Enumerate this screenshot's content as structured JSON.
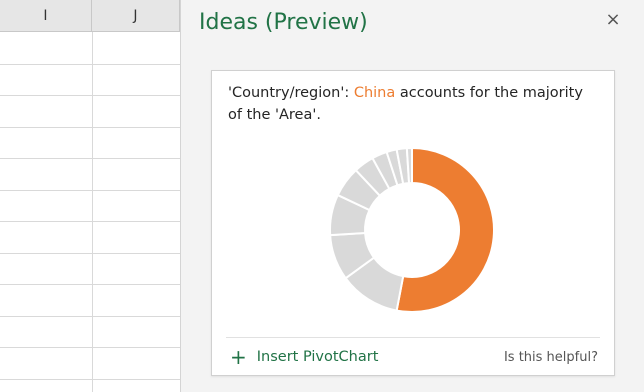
{
  "sheet": {
    "columns": [
      "I",
      "J"
    ]
  },
  "pane": {
    "title": "Ideas (Preview)",
    "close_symbol": "×"
  },
  "card": {
    "insight_prefix": "'Country/region': ",
    "insight_highlight": "China",
    "insight_suffix": " accounts for the majority of the 'Area'.",
    "insert_symbol": "+",
    "insert_label": "Insert PivotChart",
    "helpful_label": "Is this helpful?"
  },
  "colors": {
    "accent_green": "#217346",
    "highlight_orange": "#ed7d31",
    "slice_gray": "#d9d9d9"
  },
  "chart_data": {
    "type": "pie",
    "categories": [
      "China",
      "",
      "",
      "",
      "",
      "",
      "",
      "",
      "",
      ""
    ],
    "values": [
      53,
      12,
      9,
      8,
      6,
      4,
      3,
      2,
      2,
      1
    ],
    "title": "",
    "hole": true
  }
}
